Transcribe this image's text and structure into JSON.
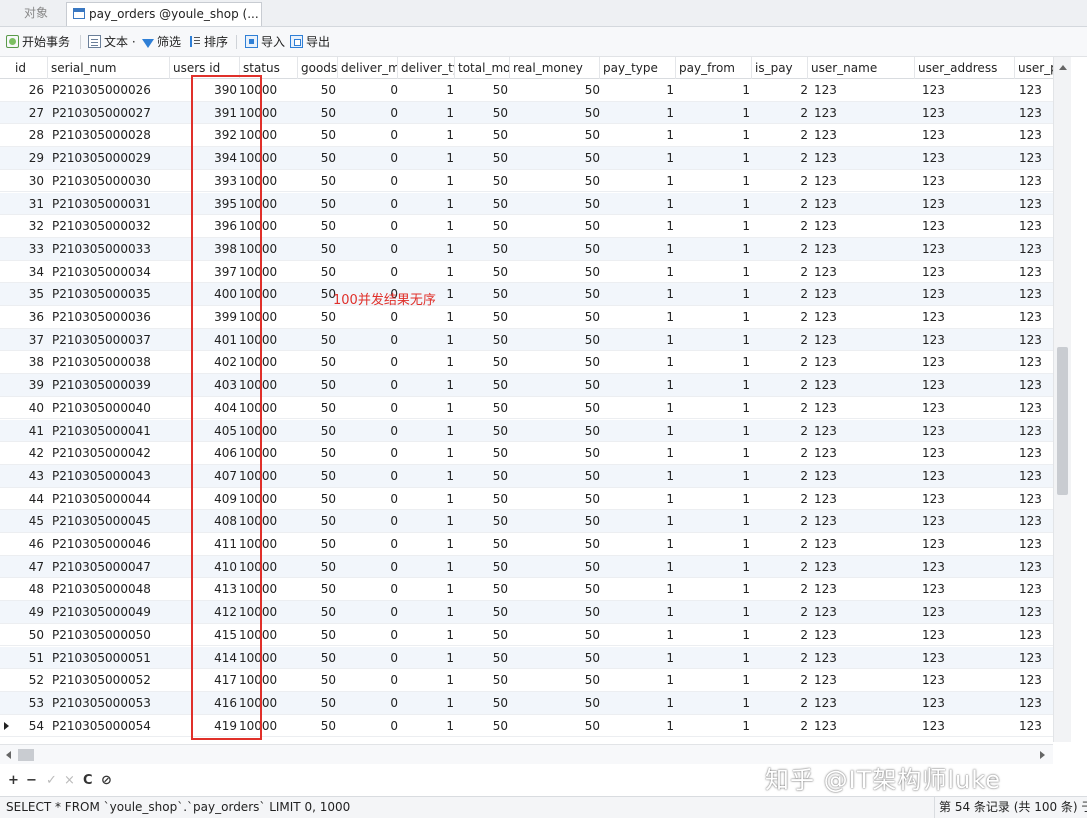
{
  "tabs": {
    "objects_label": "对象",
    "table_tab_label": "pay_orders @youle_shop (..."
  },
  "toolbar": {
    "begin_transaction": "开始事务",
    "text": "文本 ·",
    "filter": "筛选",
    "sort": "排序",
    "import": "导入",
    "export": "导出"
  },
  "columns": [
    "id",
    "serial_num",
    "users id",
    "status",
    "goods",
    "deliver_m",
    "deliver_ty",
    "total_mo",
    "real_money",
    "pay_type",
    "pay_from",
    "is_pay",
    "user_name",
    "user_address",
    "user_p"
  ],
  "rows": [
    [
      "26",
      "P210305000026",
      "390",
      "10000",
      "50",
      "0",
      "1",
      "50",
      "50",
      "1",
      "1",
      "2",
      "123",
      "123",
      "123"
    ],
    [
      "27",
      "P210305000027",
      "391",
      "10000",
      "50",
      "0",
      "1",
      "50",
      "50",
      "1",
      "1",
      "2",
      "123",
      "123",
      "123"
    ],
    [
      "28",
      "P210305000028",
      "392",
      "10000",
      "50",
      "0",
      "1",
      "50",
      "50",
      "1",
      "1",
      "2",
      "123",
      "123",
      "123"
    ],
    [
      "29",
      "P210305000029",
      "394",
      "10000",
      "50",
      "0",
      "1",
      "50",
      "50",
      "1",
      "1",
      "2",
      "123",
      "123",
      "123"
    ],
    [
      "30",
      "P210305000030",
      "393",
      "10000",
      "50",
      "0",
      "1",
      "50",
      "50",
      "1",
      "1",
      "2",
      "123",
      "123",
      "123"
    ],
    [
      "31",
      "P210305000031",
      "395",
      "10000",
      "50",
      "0",
      "1",
      "50",
      "50",
      "1",
      "1",
      "2",
      "123",
      "123",
      "123"
    ],
    [
      "32",
      "P210305000032",
      "396",
      "10000",
      "50",
      "0",
      "1",
      "50",
      "50",
      "1",
      "1",
      "2",
      "123",
      "123",
      "123"
    ],
    [
      "33",
      "P210305000033",
      "398",
      "10000",
      "50",
      "0",
      "1",
      "50",
      "50",
      "1",
      "1",
      "2",
      "123",
      "123",
      "123"
    ],
    [
      "34",
      "P210305000034",
      "397",
      "10000",
      "50",
      "0",
      "1",
      "50",
      "50",
      "1",
      "1",
      "2",
      "123",
      "123",
      "123"
    ],
    [
      "35",
      "P210305000035",
      "400",
      "10000",
      "50",
      "0",
      "1",
      "50",
      "50",
      "1",
      "1",
      "2",
      "123",
      "123",
      "123"
    ],
    [
      "36",
      "P210305000036",
      "399",
      "10000",
      "50",
      "0",
      "1",
      "50",
      "50",
      "1",
      "1",
      "2",
      "123",
      "123",
      "123"
    ],
    [
      "37",
      "P210305000037",
      "401",
      "10000",
      "50",
      "0",
      "1",
      "50",
      "50",
      "1",
      "1",
      "2",
      "123",
      "123",
      "123"
    ],
    [
      "38",
      "P210305000038",
      "402",
      "10000",
      "50",
      "0",
      "1",
      "50",
      "50",
      "1",
      "1",
      "2",
      "123",
      "123",
      "123"
    ],
    [
      "39",
      "P210305000039",
      "403",
      "10000",
      "50",
      "0",
      "1",
      "50",
      "50",
      "1",
      "1",
      "2",
      "123",
      "123",
      "123"
    ],
    [
      "40",
      "P210305000040",
      "404",
      "10000",
      "50",
      "0",
      "1",
      "50",
      "50",
      "1",
      "1",
      "2",
      "123",
      "123",
      "123"
    ],
    [
      "41",
      "P210305000041",
      "405",
      "10000",
      "50",
      "0",
      "1",
      "50",
      "50",
      "1",
      "1",
      "2",
      "123",
      "123",
      "123"
    ],
    [
      "42",
      "P210305000042",
      "406",
      "10000",
      "50",
      "0",
      "1",
      "50",
      "50",
      "1",
      "1",
      "2",
      "123",
      "123",
      "123"
    ],
    [
      "43",
      "P210305000043",
      "407",
      "10000",
      "50",
      "0",
      "1",
      "50",
      "50",
      "1",
      "1",
      "2",
      "123",
      "123",
      "123"
    ],
    [
      "44",
      "P210305000044",
      "409",
      "10000",
      "50",
      "0",
      "1",
      "50",
      "50",
      "1",
      "1",
      "2",
      "123",
      "123",
      "123"
    ],
    [
      "45",
      "P210305000045",
      "408",
      "10000",
      "50",
      "0",
      "1",
      "50",
      "50",
      "1",
      "1",
      "2",
      "123",
      "123",
      "123"
    ],
    [
      "46",
      "P210305000046",
      "411",
      "10000",
      "50",
      "0",
      "1",
      "50",
      "50",
      "1",
      "1",
      "2",
      "123",
      "123",
      "123"
    ],
    [
      "47",
      "P210305000047",
      "410",
      "10000",
      "50",
      "0",
      "1",
      "50",
      "50",
      "1",
      "1",
      "2",
      "123",
      "123",
      "123"
    ],
    [
      "48",
      "P210305000048",
      "413",
      "10000",
      "50",
      "0",
      "1",
      "50",
      "50",
      "1",
      "1",
      "2",
      "123",
      "123",
      "123"
    ],
    [
      "49",
      "P210305000049",
      "412",
      "10000",
      "50",
      "0",
      "1",
      "50",
      "50",
      "1",
      "1",
      "2",
      "123",
      "123",
      "123"
    ],
    [
      "50",
      "P210305000050",
      "415",
      "10000",
      "50",
      "0",
      "1",
      "50",
      "50",
      "1",
      "1",
      "2",
      "123",
      "123",
      "123"
    ],
    [
      "51",
      "P210305000051",
      "414",
      "10000",
      "50",
      "0",
      "1",
      "50",
      "50",
      "1",
      "1",
      "2",
      "123",
      "123",
      "123"
    ],
    [
      "52",
      "P210305000052",
      "417",
      "10000",
      "50",
      "0",
      "1",
      "50",
      "50",
      "1",
      "1",
      "2",
      "123",
      "123",
      "123"
    ],
    [
      "53",
      "P210305000053",
      "416",
      "10000",
      "50",
      "0",
      "1",
      "50",
      "50",
      "1",
      "1",
      "2",
      "123",
      "123",
      "123"
    ],
    [
      "54",
      "P210305000054",
      "419",
      "10000",
      "50",
      "0",
      "1",
      "50",
      "50",
      "1",
      "1",
      "2",
      "123",
      "123",
      "123"
    ]
  ],
  "annotation": "100并发结果无序",
  "nav": {
    "add": "+",
    "remove": "−",
    "apply": "✓",
    "discard": "×",
    "refresh": "C",
    "stop": "⊘"
  },
  "watermark": "知乎 @IT架构师luke",
  "status": {
    "sql": "SELECT * FROM `youle_shop`.`pay_orders` LIMIT 0, 1000",
    "records": "第 54 条记录 (共 100 条) 于第"
  },
  "colors": {
    "highlight": "#e0302a",
    "row_alt": "#f2f6fb",
    "accent": "#2f7fd6"
  }
}
